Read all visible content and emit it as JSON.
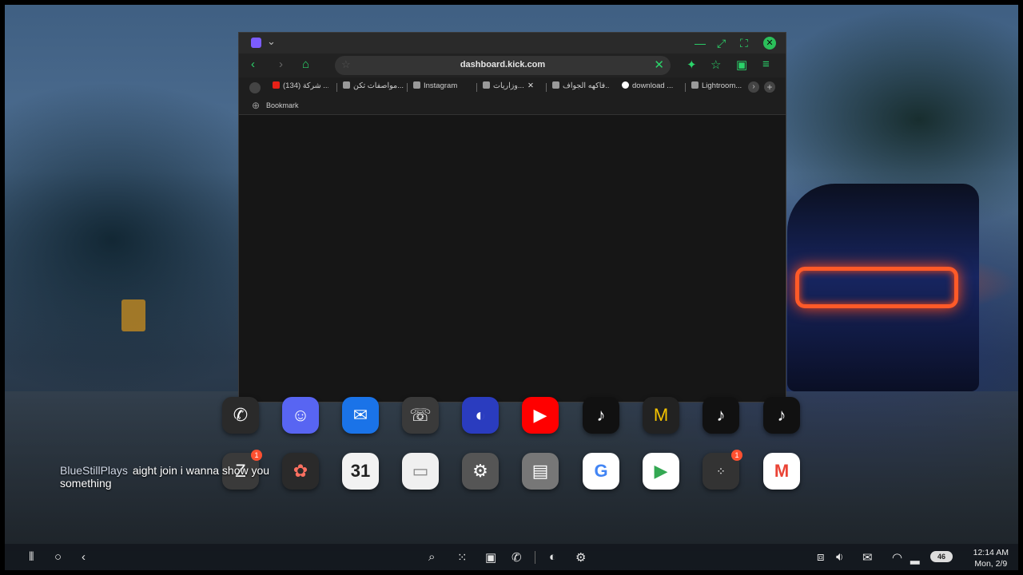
{
  "browser": {
    "url": "dashboard.kick.com",
    "tabs": [
      {
        "label": "(134) شركة ..."
      },
      {
        "label": "مواصفات تكن..."
      },
      {
        "label": "Instagram"
      },
      {
        "label": "وزاريات..."
      },
      {
        "label": "فاكهه الجواف..."
      },
      {
        "label": "download ..."
      },
      {
        "label": "Lightroom..."
      }
    ],
    "tab_close_glyph": "✕",
    "bookmark_label": "Bookmark"
  },
  "dock": {
    "row1": [
      {
        "name": "whatsapp-icon",
        "color": "#2a2a2a"
      },
      {
        "name": "discord-icon",
        "color": "#5865f2"
      },
      {
        "name": "messages-icon",
        "color": "#1a73e8"
      },
      {
        "name": "phone-icon",
        "color": "#3a3a3a"
      },
      {
        "name": "browser-icon",
        "color": "#2a3cbf"
      },
      {
        "name": "youtube-icon",
        "color": "#ff0000"
      },
      {
        "name": "tiktok-icon",
        "color": "#111111"
      },
      {
        "name": "mail-app-icon",
        "color": "#222222"
      },
      {
        "name": "tiktok-icon-2",
        "color": "#111111"
      },
      {
        "name": "tiktok-icon-3",
        "color": "#111111"
      }
    ],
    "row2": [
      {
        "name": "notes-app-icon",
        "color": "#3a3a3a",
        "badge": "1"
      },
      {
        "name": "gallery-icon",
        "color": "#2a2a2a"
      },
      {
        "name": "calendar-icon",
        "color": "#f2f2f2",
        "text": "31"
      },
      {
        "name": "files-icon",
        "color": "#f0f0f0"
      },
      {
        "name": "settings-icon",
        "color": "#555555"
      },
      {
        "name": "memo-icon",
        "color": "#777777"
      },
      {
        "name": "google-icon",
        "color": "#ffffff"
      },
      {
        "name": "play-store-icon",
        "color": "#ffffff"
      },
      {
        "name": "folder-apps-icon",
        "color": "#333333",
        "badge": "1"
      },
      {
        "name": "gmail-icon",
        "color": "#ffffff"
      }
    ]
  },
  "chat": {
    "username": "BlueStillPlays",
    "message": "aight join i wanna show you something"
  },
  "status": {
    "battery": "46",
    "time": "12:14 AM",
    "date": "Mon, 2/9"
  }
}
